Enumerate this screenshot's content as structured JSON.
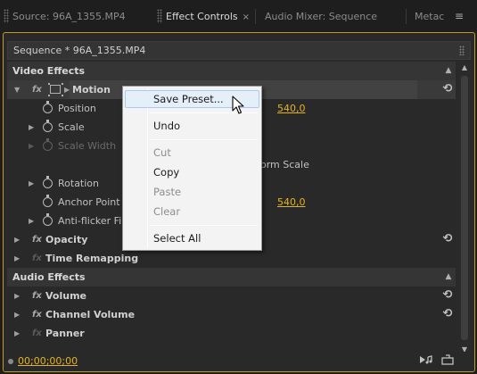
{
  "tabs": [
    {
      "label": "Source: 96A_1355.MP4",
      "active": false
    },
    {
      "label": "Effect Controls",
      "active": true,
      "close": "×"
    },
    {
      "label": "Audio Mixer: Sequence",
      "active": false
    },
    {
      "label": "Metac",
      "active": false
    }
  ],
  "panel_menu_icon": "≡",
  "sequence_label": "Sequence * 96A_1355.MP4",
  "sections": {
    "video": "Video Effects",
    "audio": "Audio Effects"
  },
  "rows": {
    "motion": "Motion",
    "position": {
      "label": "Position",
      "value": "540,0"
    },
    "scale": "Scale",
    "scale_width": "Scale Width",
    "uniform_scale": "orm Scale",
    "rotation": "Rotation",
    "anchor": {
      "label": "Anchor Point",
      "value": "540,0"
    },
    "antiflicker": "Anti-flicker Filt",
    "opacity": "Opacity",
    "time_remap": "Time Remapping",
    "volume": "Volume",
    "channel_volume": "Channel Volume",
    "panner": "Panner"
  },
  "icons": {
    "fx": "fx",
    "expand": "▶",
    "collapse": "▼",
    "reset": "⟲",
    "scroll_up": "▲",
    "scroll_down": "▼"
  },
  "footer": {
    "timecode": "00;00;00;00"
  },
  "context_menu": {
    "items": [
      {
        "label": "Save Preset...",
        "enabled": true,
        "hover": true
      },
      {
        "label": "Undo",
        "enabled": true
      },
      {
        "label": "Cut",
        "enabled": false
      },
      {
        "label": "Copy",
        "enabled": true
      },
      {
        "label": "Paste",
        "enabled": false
      },
      {
        "label": "Clear",
        "enabled": false
      },
      {
        "label": "Select All",
        "enabled": true
      }
    ]
  },
  "colors": {
    "accent": "#e2b328",
    "panel_border": "#c29a1d",
    "panel_bg": "#292929"
  }
}
